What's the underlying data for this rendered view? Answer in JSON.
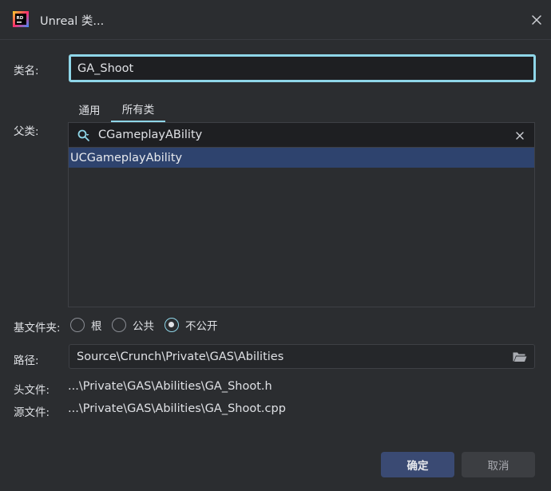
{
  "window": {
    "title": "Unreal 类...",
    "logo_text": "RD",
    "logo_colors": [
      "#ff2e6a",
      "#ffd028",
      "#3c8cff"
    ]
  },
  "form": {
    "class_name_label": "类名:",
    "class_name_value": "GA_Shoot",
    "parent_label": "父类:",
    "tabs": [
      {
        "label": "通用",
        "active": false
      },
      {
        "label": "所有类",
        "active": true
      }
    ],
    "search_value": "CGameplayABility",
    "results": [
      "UCGameplayAbility"
    ],
    "base_folder_label": "基文件夹:",
    "base_folder_options": [
      {
        "label": "根",
        "checked": false
      },
      {
        "label": "公共",
        "checked": false
      },
      {
        "label": "不公开",
        "checked": true
      }
    ],
    "path_label": "路径:",
    "path_value": "Source\\Crunch\\Private\\GAS\\Abilities",
    "header_label": "头文件:",
    "header_value": "...\\Private\\GAS\\Abilities\\GA_Shoot.h",
    "source_label": "源文件:",
    "source_value": "...\\Private\\GAS\\Abilities\\GA_Shoot.cpp"
  },
  "buttons": {
    "ok": "确定",
    "cancel": "取消"
  },
  "icons": {
    "close": "close-icon",
    "search": "search-icon",
    "clear": "clear-icon",
    "folder": "folder-icon"
  },
  "colors": {
    "accent": "#8fd6e8",
    "selection": "#2e436e",
    "primary_button": "#3a4a73"
  }
}
